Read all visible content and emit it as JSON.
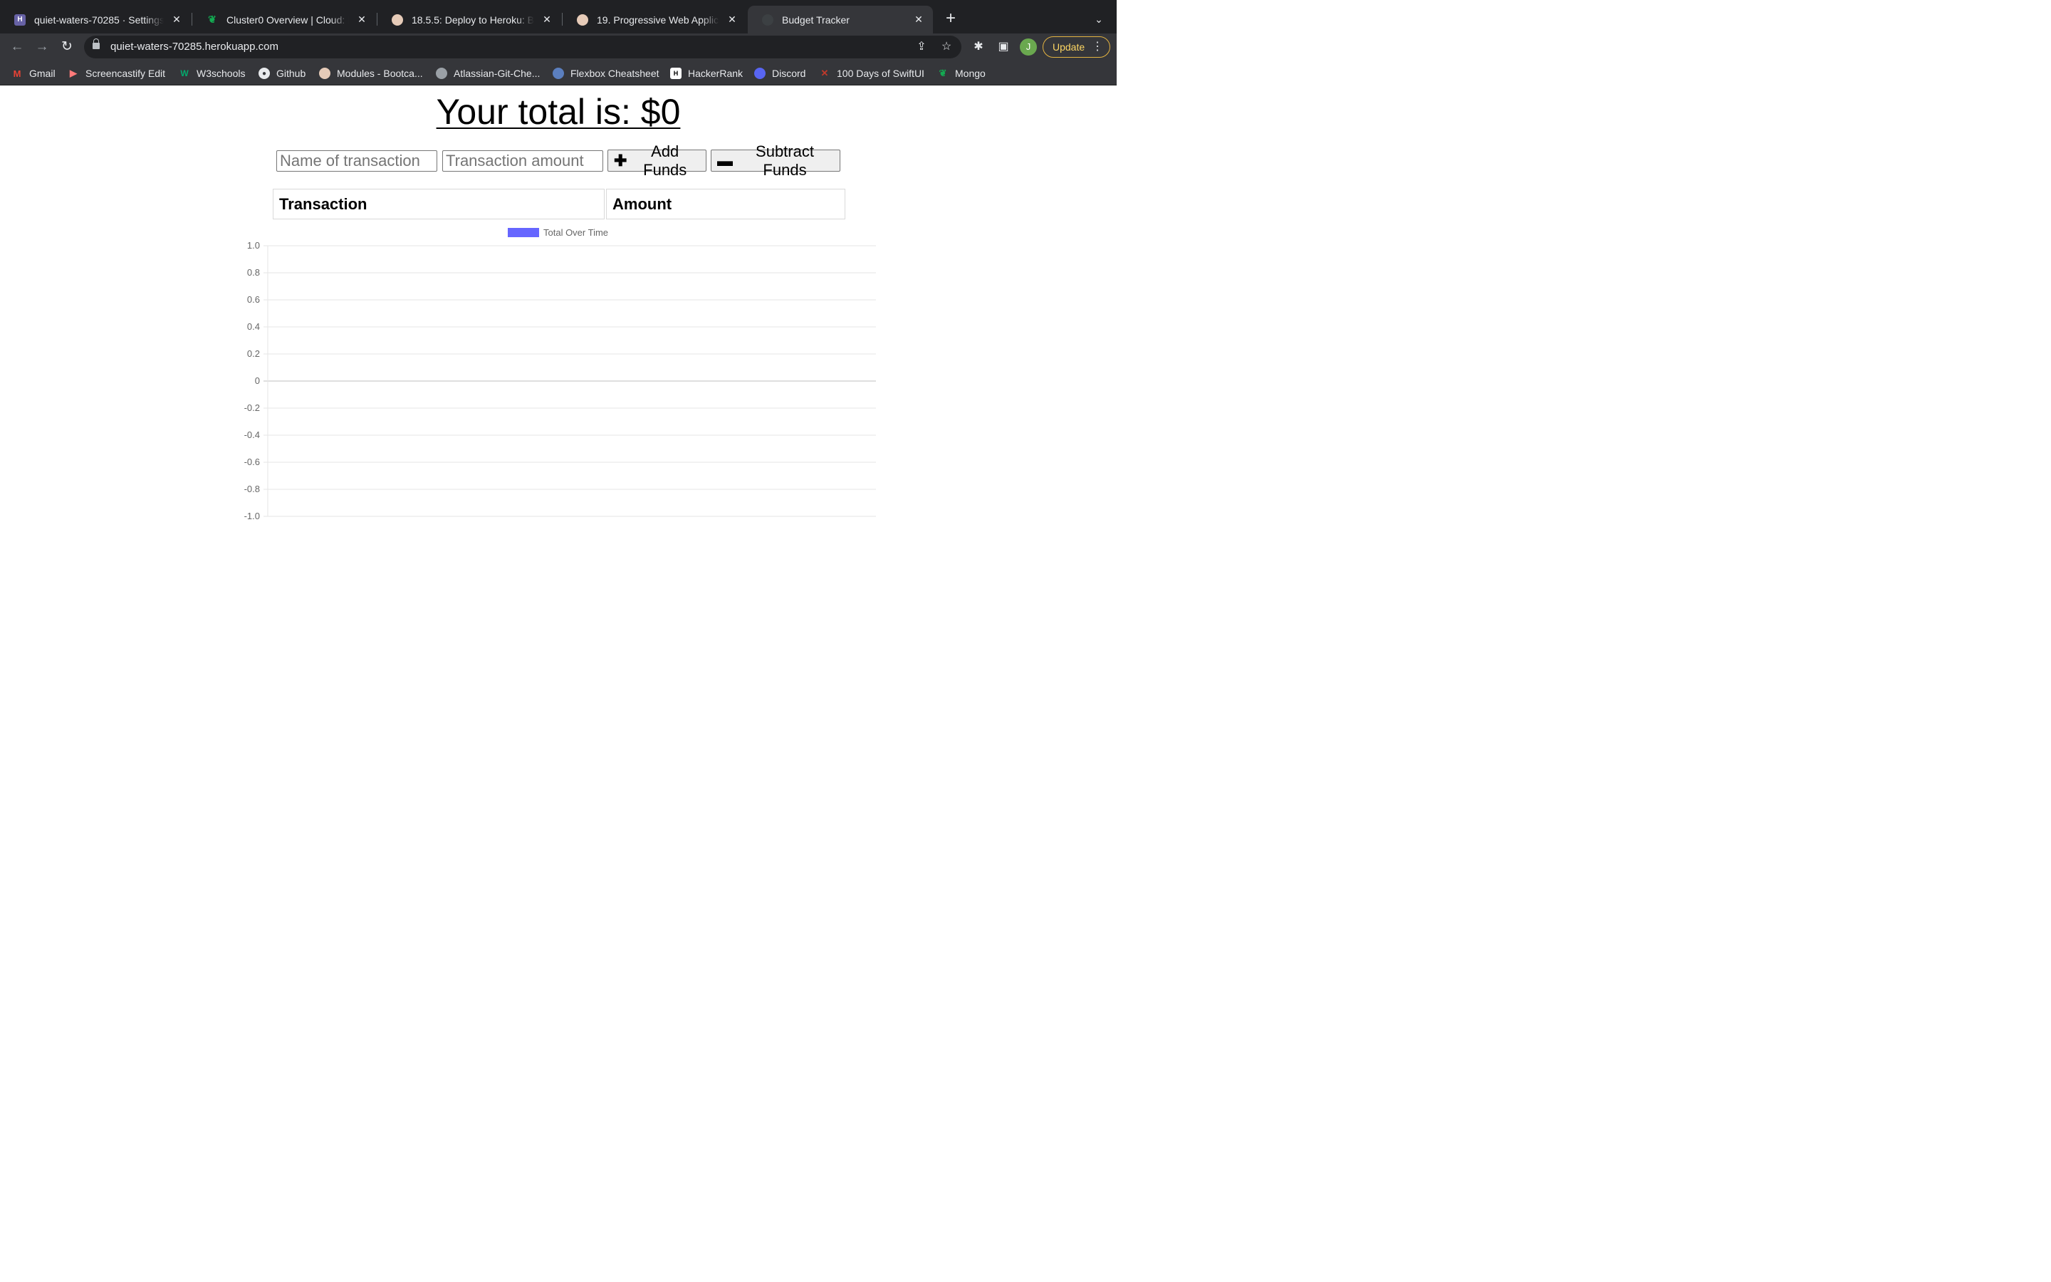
{
  "browser": {
    "tabs": [
      {
        "title": "quiet-waters-70285 · Settings",
        "icon": "heroku-icon",
        "color": "#6762a6"
      },
      {
        "title": "Cluster0 Overview | Cloud: MongoDB Cloud",
        "icon": "mongodb-leaf-icon",
        "color": "#13aa52"
      },
      {
        "title": "18.5.5: Deploy to Heroku: Bootcamp",
        "icon": "bootcamp-icon",
        "color": "#d8b6a0"
      },
      {
        "title": "19. Progressive Web Applications",
        "icon": "bootcamp-icon",
        "color": "#d8b6a0"
      },
      {
        "title": "Budget Tracker",
        "icon": "money-bag-icon",
        "color": "#3c4043"
      }
    ],
    "active_tab": 4,
    "url": "quiet-waters-70285.herokuapp.com",
    "profile_initial": "J",
    "update_label": "Update",
    "bookmarks": [
      {
        "label": "Gmail",
        "icon": "gmail-icon"
      },
      {
        "label": "Screencastify Edit",
        "icon": "screencastify-icon"
      },
      {
        "label": "W3schools",
        "icon": "w3schools-icon"
      },
      {
        "label": "Github",
        "icon": "github-icon"
      },
      {
        "label": "Modules - Bootca...",
        "icon": "bootcamp-icon"
      },
      {
        "label": "Atlassian-Git-Che...",
        "icon": "globe-icon"
      },
      {
        "label": "Flexbox Cheatsheet",
        "icon": "flexbox-icon"
      },
      {
        "label": "HackerRank",
        "icon": "hackerrank-icon"
      },
      {
        "label": "Discord",
        "icon": "discord-icon"
      },
      {
        "label": "100 Days of SwiftUI",
        "icon": "swift-icon"
      },
      {
        "label": "Mongo",
        "icon": "mongodb-leaf-icon"
      }
    ]
  },
  "page": {
    "total_text": "Your total is: $0",
    "name_placeholder": "Name of transaction",
    "amount_placeholder": "Transaction amount",
    "add_label": "Add Funds",
    "subtract_label": "Subtract Funds",
    "table_headers": [
      "Transaction",
      "Amount"
    ]
  },
  "chart_data": {
    "type": "line",
    "title": "",
    "series": [
      {
        "name": "Total Over Time",
        "values": [],
        "color": "#6666ff"
      }
    ],
    "x": [],
    "xlabel": "",
    "ylabel": "",
    "ylim": [
      -1.0,
      1.0
    ],
    "yticks": [
      "1.0",
      "0.8",
      "0.6",
      "0.4",
      "0.2",
      "0",
      "-0.2",
      "-0.4",
      "-0.6",
      "-0.8",
      "-1.0"
    ],
    "grid": true,
    "legend_position": "top"
  }
}
